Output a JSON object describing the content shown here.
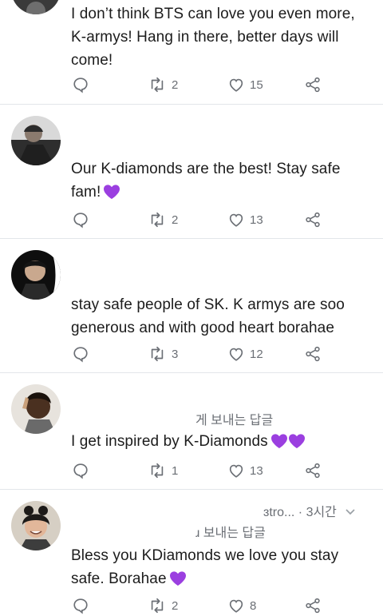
{
  "tweets": [
    {
      "text": "I don’t think BTS can love you even more, K-armys! Hang in there, better days will come!",
      "emoji": "",
      "retweets": "2",
      "likes": "15"
    },
    {
      "text": "Our K-diamonds are the best! Stay safe fam!",
      "emoji": "purple-heart",
      "retweets": "2",
      "likes": "13"
    },
    {
      "text": "stay safe people of SK. K armys are soo generous and with good heart borahae",
      "emoji": "",
      "retweets": "3",
      "likes": "12"
    },
    {
      "text": "I get inspired by K-Diamonds",
      "emoji": "two-purple-hearts",
      "reply_context": "게 보내는 답글",
      "retweets": "1",
      "likes": "13"
    },
    {
      "handle_time": "ɜtro... · 3시간",
      "reply_context": "ɹ 보내는 답글",
      "text": "Bless you KDiamonds we love you stay safe. Borahae",
      "emoji": "purple-heart",
      "retweets": "2",
      "likes": "8"
    }
  ],
  "colors": {
    "purple_heart": "#9b3fe0",
    "icon_gray": "#6b6f75",
    "divider": "#e3e6ea"
  }
}
